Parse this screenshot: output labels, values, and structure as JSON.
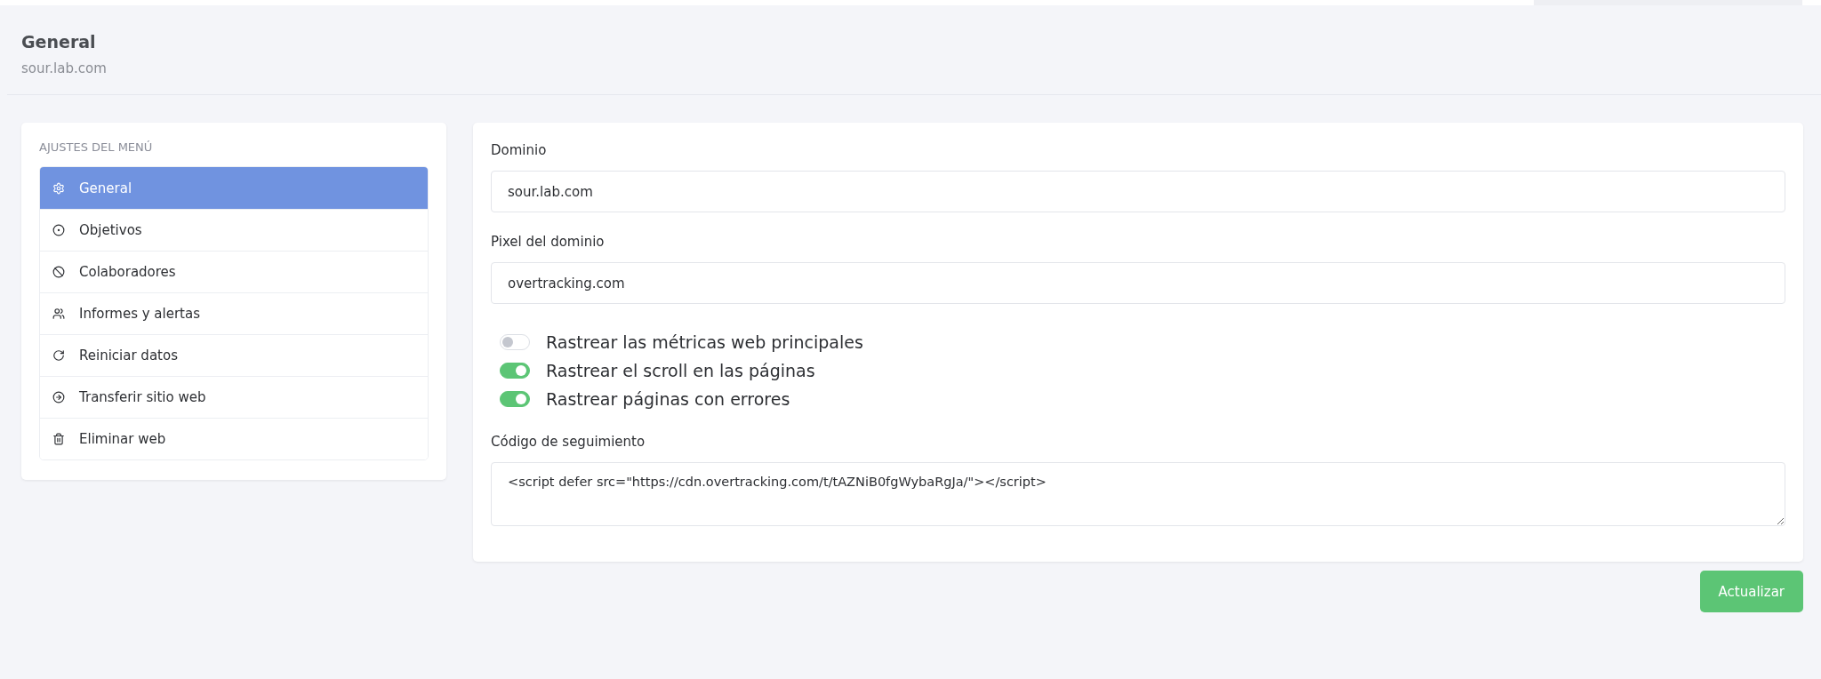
{
  "header": {
    "title": "General",
    "subtitle": "sour.lab.com"
  },
  "sidebar": {
    "heading": "AJUSTES DEL MENÚ",
    "items": [
      {
        "label": "General",
        "selected": true
      },
      {
        "label": "Objetivos",
        "selected": false
      },
      {
        "label": "Colaboradores",
        "selected": false
      },
      {
        "label": "Informes y alertas",
        "selected": false
      },
      {
        "label": "Reiniciar datos",
        "selected": false
      },
      {
        "label": "Transferir sitio web",
        "selected": false
      },
      {
        "label": "Eliminar web",
        "selected": false
      }
    ]
  },
  "form": {
    "fields": [
      {
        "label": "Dominio",
        "value": "sour.lab.com"
      },
      {
        "label": "Pixel del dominio",
        "value": "overtracking.com"
      }
    ],
    "toggles": [
      {
        "label": "Rastrear las métricas web principales",
        "on": false
      },
      {
        "label": "Rastrear el scroll en las páginas",
        "on": true
      },
      {
        "label": "Rastrear páginas con errores",
        "on": true
      }
    ],
    "code": {
      "label": "Código de seguimiento",
      "value": "<script defer src=\"https://cdn.overtracking.com/t/tAZNiB0fgWybaRgJa/\"></script>"
    }
  },
  "button": "Actualizar"
}
